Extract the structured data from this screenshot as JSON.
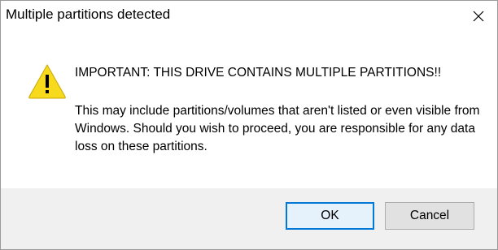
{
  "window": {
    "title": "Multiple partitions detected",
    "close_icon": "close-icon"
  },
  "content": {
    "icon": "warning-icon",
    "heading": "IMPORTANT: THIS DRIVE CONTAINS MULTIPLE PARTITIONS!!",
    "message": "This may include partitions/volumes that aren't listed or even visible from Windows. Should you wish to proceed, you are responsible for any data loss on these partitions."
  },
  "buttons": {
    "ok_label": "OK",
    "cancel_label": "Cancel"
  },
  "colors": {
    "accent": "#0078d7",
    "warning": "#f7d91d",
    "footer_bg": "#f0f0f0"
  }
}
